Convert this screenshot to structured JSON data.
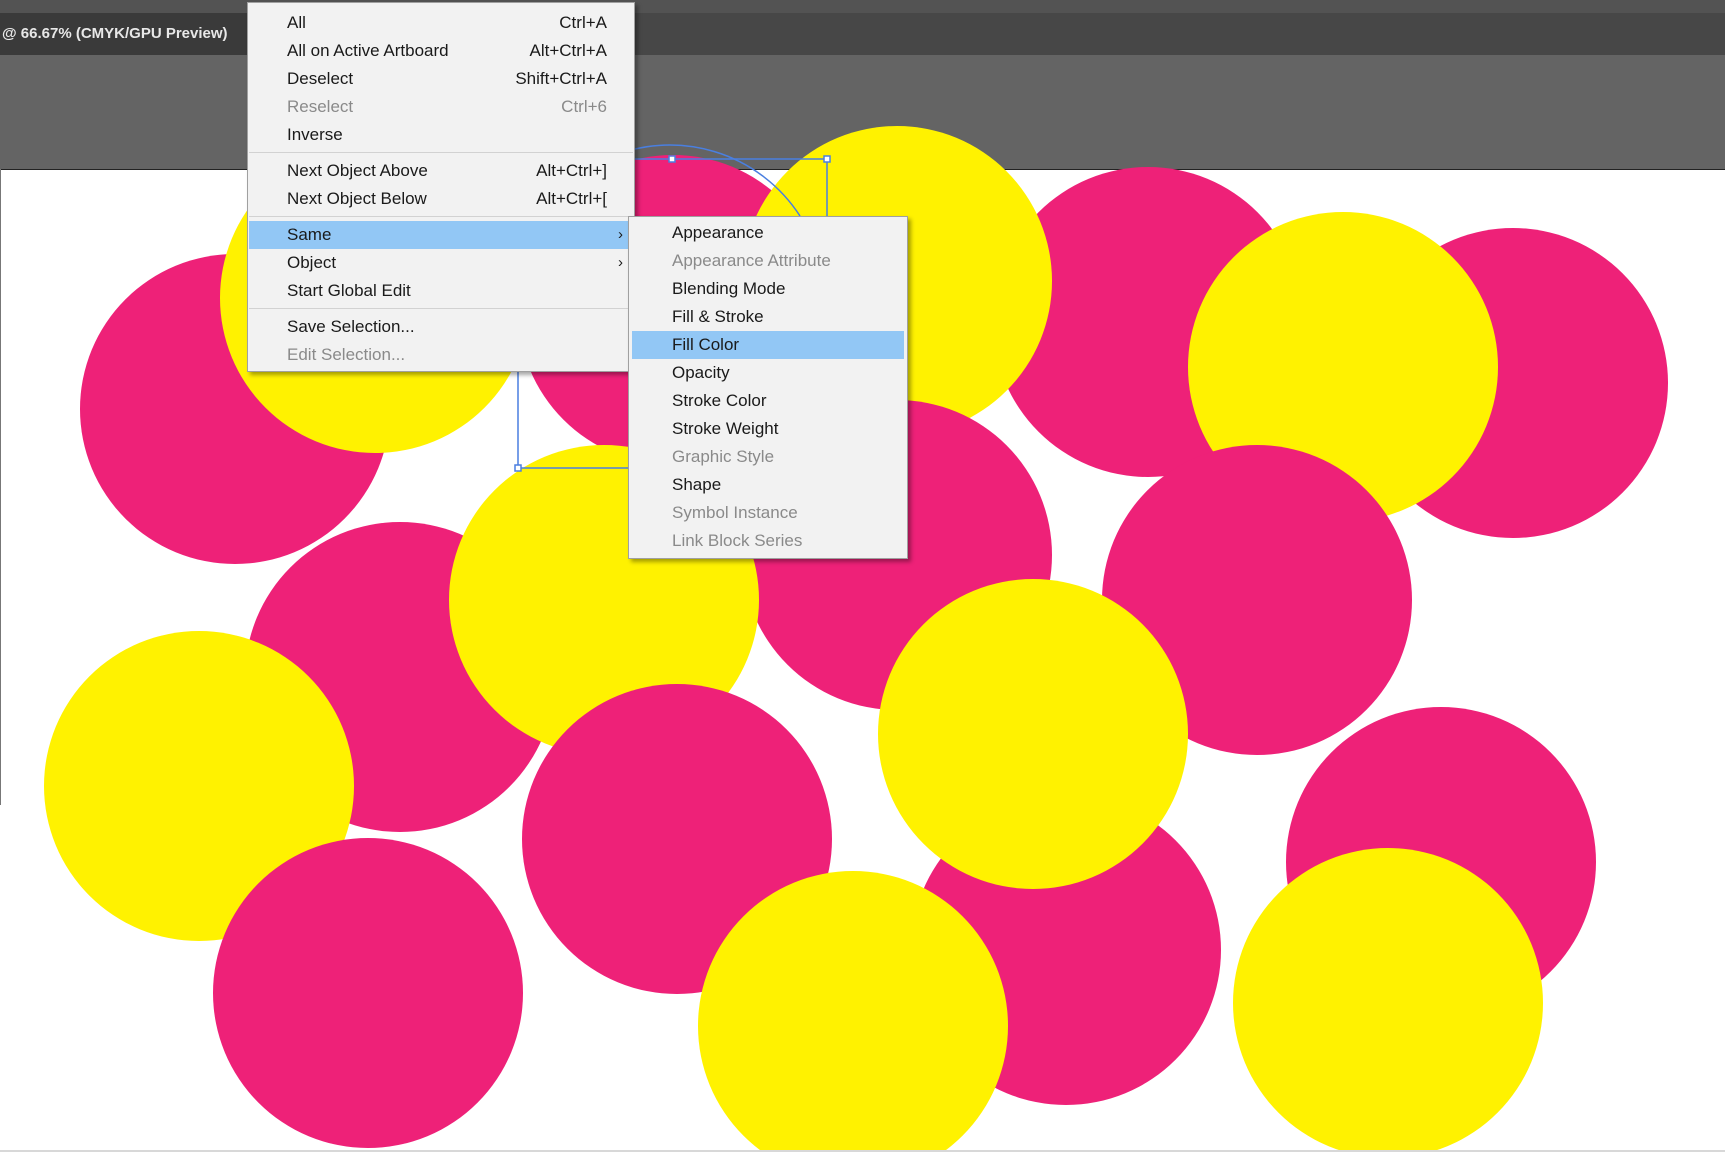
{
  "document_tab": {
    "title": "@ 66.67% (CMYK/GPU Preview)"
  },
  "colors": {
    "magenta": "#ee2178",
    "yellow": "#fff200",
    "selection_blue": "#4a7fe0",
    "menu_highlight": "#92c7f5"
  },
  "select_menu": {
    "items": [
      {
        "label": "All",
        "shortcut": "Ctrl+A",
        "disabled": false
      },
      {
        "label": "All on Active Artboard",
        "shortcut": "Alt+Ctrl+A",
        "disabled": false
      },
      {
        "label": "Deselect",
        "shortcut": "Shift+Ctrl+A",
        "disabled": false
      },
      {
        "label": "Reselect",
        "shortcut": "Ctrl+6",
        "disabled": true
      },
      {
        "label": "Inverse",
        "shortcut": "",
        "disabled": false
      },
      {
        "label": "Next Object Above",
        "shortcut": "Alt+Ctrl+]",
        "disabled": false
      },
      {
        "label": "Next Object Below",
        "shortcut": "Alt+Ctrl+[",
        "disabled": false
      },
      {
        "label": "Same",
        "shortcut": "",
        "submenu": true,
        "highlighted": true
      },
      {
        "label": "Object",
        "shortcut": "",
        "submenu": true
      },
      {
        "label": "Start Global Edit",
        "shortcut": ""
      },
      {
        "label": "Save Selection...",
        "shortcut": ""
      },
      {
        "label": "Edit Selection...",
        "shortcut": "",
        "disabled": true
      }
    ]
  },
  "same_submenu": {
    "items": [
      {
        "label": "Appearance",
        "disabled": false
      },
      {
        "label": "Appearance Attribute",
        "disabled": true
      },
      {
        "label": "Blending Mode",
        "disabled": false
      },
      {
        "label": "Fill & Stroke",
        "disabled": false
      },
      {
        "label": "Fill Color",
        "disabled": false,
        "highlighted": true
      },
      {
        "label": "Opacity",
        "disabled": false
      },
      {
        "label": "Stroke Color",
        "disabled": false
      },
      {
        "label": "Stroke Weight",
        "disabled": false
      },
      {
        "label": "Graphic Style",
        "disabled": true
      },
      {
        "label": "Shape",
        "disabled": false
      },
      {
        "label": "Symbol Instance",
        "disabled": true
      },
      {
        "label": "Link Block Series",
        "disabled": true
      }
    ]
  }
}
